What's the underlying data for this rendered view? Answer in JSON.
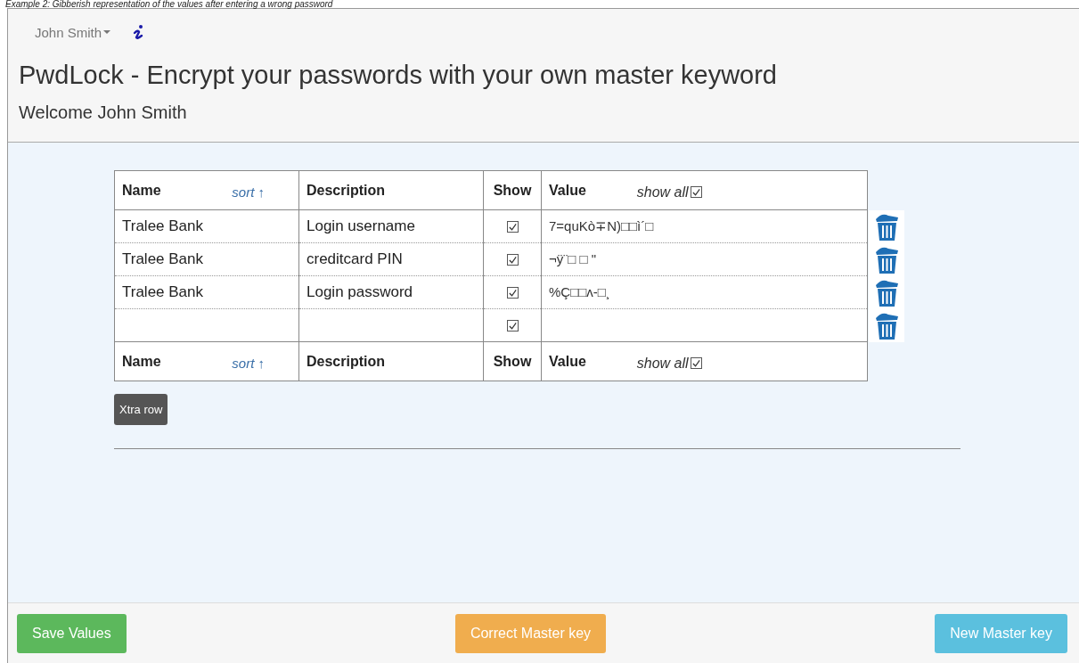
{
  "caption": "Example 2: Gibberish representation of the values after entering a wrong password",
  "user_menu": {
    "label": "John Smith"
  },
  "title": "PwdLock - Encrypt your passwords with your own master keyword",
  "welcome": "Welcome John Smith",
  "table": {
    "columns": [
      {
        "label": "Name",
        "sort": "sort ↑"
      },
      {
        "label": "Description"
      },
      {
        "label": "Show"
      },
      {
        "label": "Value",
        "show_all": "show all",
        "show_all_checked": true
      }
    ],
    "rows": [
      {
        "name": "Tralee Bank",
        "description": "Login username",
        "show": true,
        "value": "7=quKò∓N)□□ì´□"
      },
      {
        "name": "Tralee Bank",
        "description": "creditcard PIN",
        "show": true,
        "value": "¬ÿ¨□ □ \""
      },
      {
        "name": "Tralee Bank",
        "description": "Login password",
        "show": true,
        "value": "%Ç□□ᴧ-□¸"
      },
      {
        "name": "",
        "description": "",
        "show": true,
        "value": ""
      }
    ],
    "footer_columns": [
      {
        "label": "Name",
        "sort": "sort ↑"
      },
      {
        "label": "Description"
      },
      {
        "label": "Show"
      },
      {
        "label": "Value",
        "show_all": "show all",
        "show_all_checked": true
      }
    ]
  },
  "extra_row_button": "Xtra row",
  "footer_buttons": [
    {
      "label": "Save Values",
      "kind": "success"
    },
    {
      "label": "Correct Master key",
      "kind": "warning"
    },
    {
      "label": "New Master key",
      "kind": "info"
    }
  ]
}
